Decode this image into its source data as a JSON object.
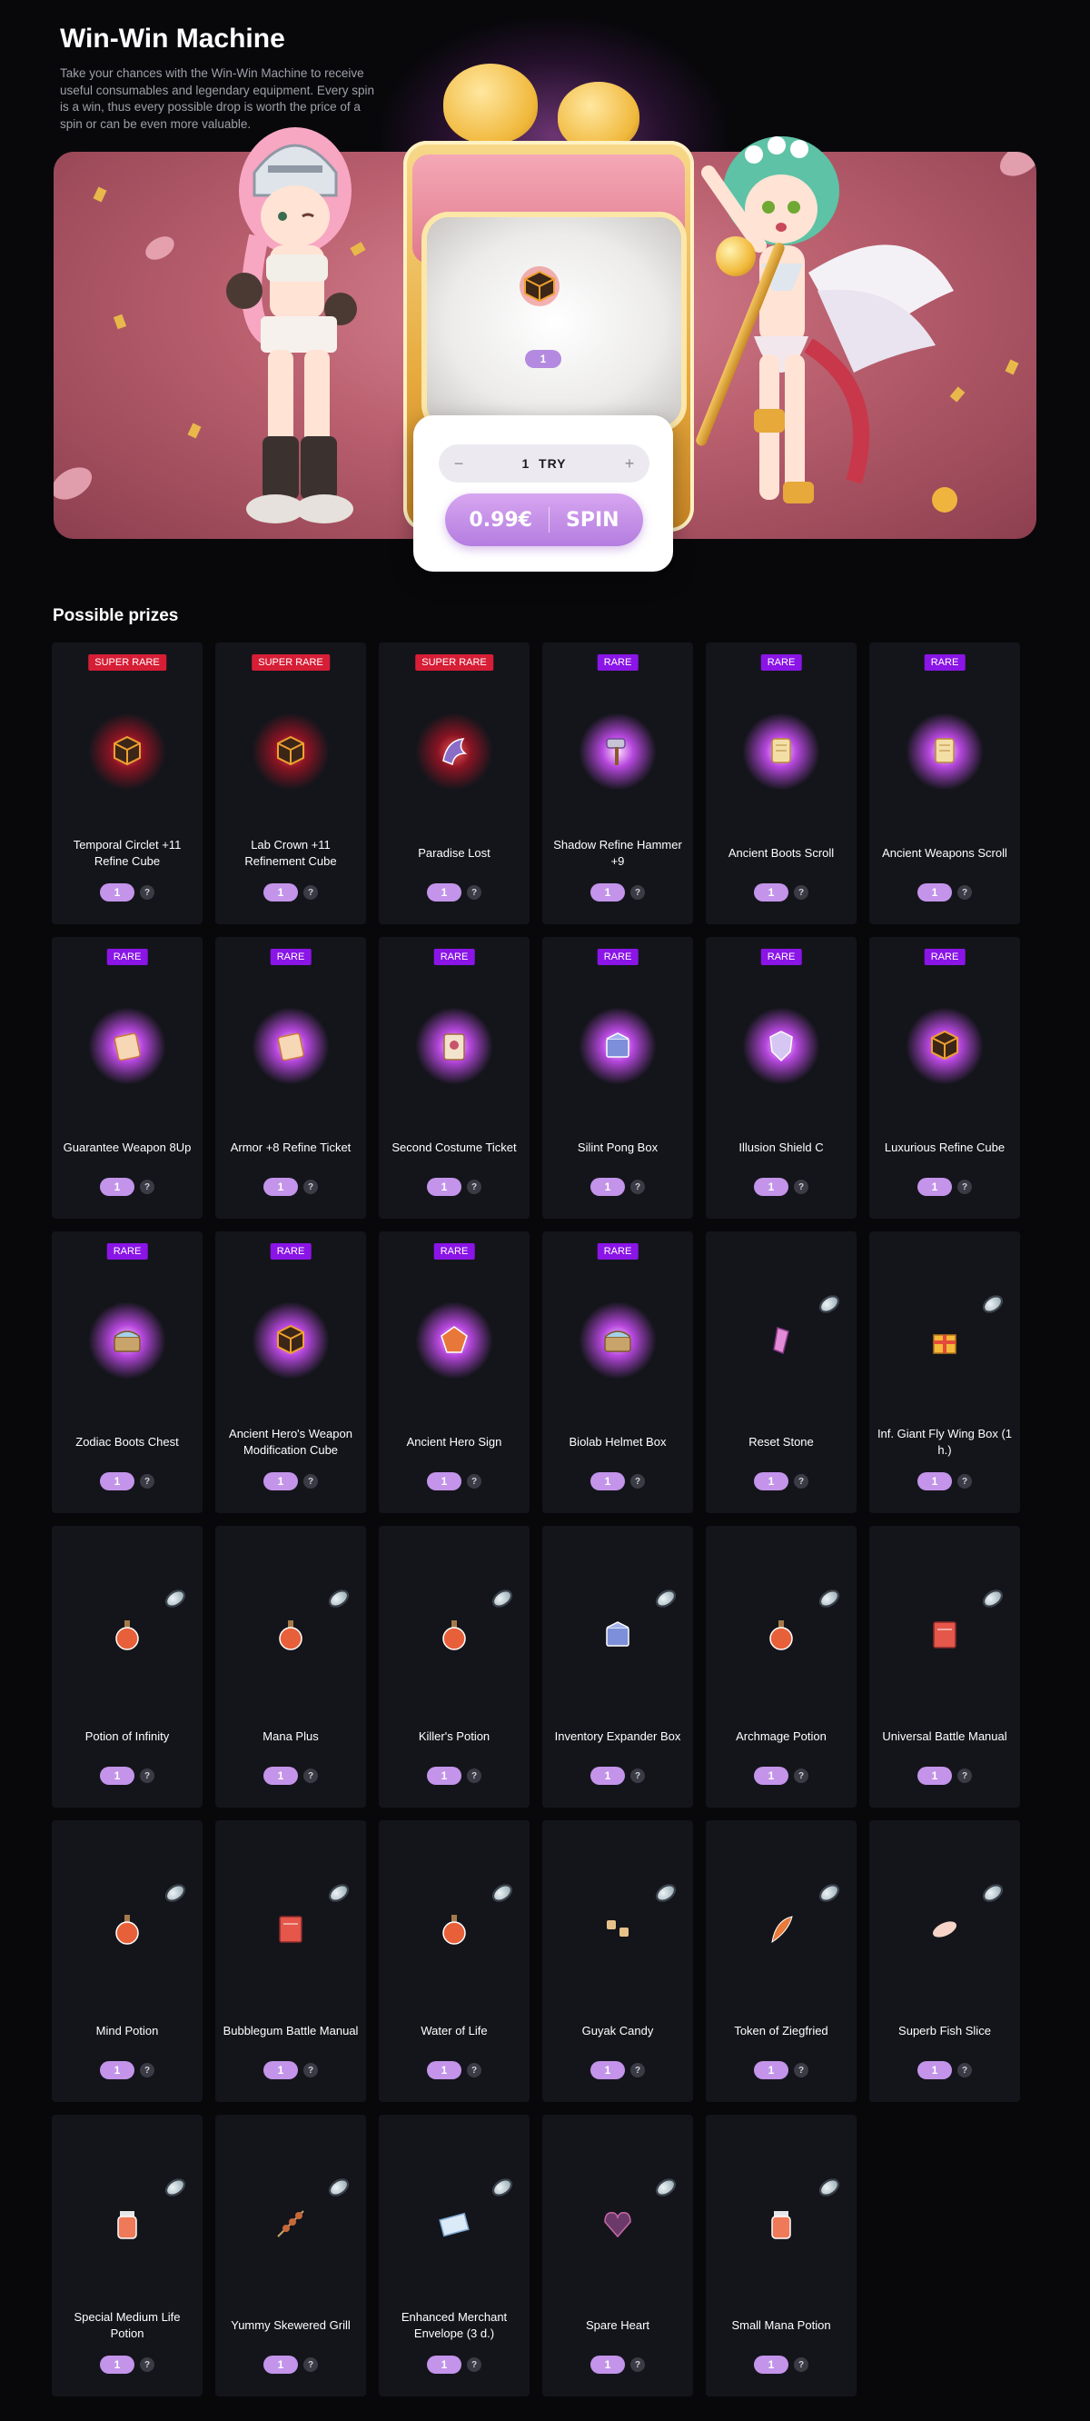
{
  "header": {
    "title": "Win-Win Machine",
    "description": "Take your chances with the Win-Win Machine to receive useful consumables and legendary equipment. Every spin is a win, thus every possible drop is worth the price of a spin or can be even more valuable."
  },
  "machine": {
    "screen_item_icon": "cube-icon",
    "screen_count": "1",
    "try_minus": "−",
    "try_label": "1  TRY",
    "try_plus": "+",
    "spin_price": "0.99€",
    "spin_label": "SPIN"
  },
  "colors": {
    "super_rare": "#d61e36",
    "rare": "#8a15e6",
    "accent": "#c394ea",
    "card_bg": "#14151b"
  },
  "prizes": {
    "title": "Possible prizes",
    "items": [
      {
        "badge": "SUPER RARE",
        "tier": "super",
        "name": "Temporal Circlet +11 Refine Cube",
        "qty": "1",
        "icon": "cube-icon"
      },
      {
        "badge": "SUPER RARE",
        "tier": "super",
        "name": "Lab Crown +11 Refinement Cube",
        "qty": "1",
        "icon": "cube-icon"
      },
      {
        "badge": "SUPER RARE",
        "tier": "super",
        "name": "Paradise Lost",
        "qty": "1",
        "icon": "dragon-icon"
      },
      {
        "badge": "RARE",
        "tier": "rare",
        "name": "Shadow Refine Hammer +9",
        "qty": "1",
        "icon": "hammer-icon"
      },
      {
        "badge": "RARE",
        "tier": "rare",
        "name": "Ancient Boots Scroll",
        "qty": "1",
        "icon": "scroll-icon"
      },
      {
        "badge": "RARE",
        "tier": "rare",
        "name": "Ancient Weapons Scroll",
        "qty": "1",
        "icon": "scroll-icon"
      },
      {
        "badge": "RARE",
        "tier": "rare",
        "name": "Guarantee Weapon 8Up",
        "qty": "1",
        "icon": "ticket-icon"
      },
      {
        "badge": "RARE",
        "tier": "rare",
        "name": "Armor +8 Refine Ticket",
        "qty": "1",
        "icon": "ticket-icon"
      },
      {
        "badge": "RARE",
        "tier": "rare",
        "name": "Second Costume Ticket",
        "qty": "1",
        "icon": "card-icon"
      },
      {
        "badge": "RARE",
        "tier": "rare",
        "name": "Silint Pong Box",
        "qty": "1",
        "icon": "box-icon"
      },
      {
        "badge": "RARE",
        "tier": "rare",
        "name": "Illusion Shield C",
        "qty": "1",
        "icon": "shield-icon"
      },
      {
        "badge": "RARE",
        "tier": "rare",
        "name": "Luxurious Refine Cube",
        "qty": "1",
        "icon": "cube-icon"
      },
      {
        "badge": "RARE",
        "tier": "rare",
        "name": "Zodiac Boots Chest",
        "qty": "1",
        "icon": "chest-icon"
      },
      {
        "badge": "RARE",
        "tier": "rare",
        "name": "Ancient Hero's Weapon Modification Cube",
        "qty": "1",
        "icon": "cube-icon"
      },
      {
        "badge": "RARE",
        "tier": "rare",
        "name": "Ancient Hero Sign",
        "qty": "1",
        "icon": "emblem-icon"
      },
      {
        "badge": "RARE",
        "tier": "rare",
        "name": "Biolab Helmet Box",
        "qty": "1",
        "icon": "chest-icon"
      },
      {
        "badge": "",
        "tier": "common",
        "name": "Reset Stone",
        "qty": "1",
        "icon": "stone-icon"
      },
      {
        "badge": "",
        "tier": "common",
        "name": "Inf. Giant Fly Wing Box (1 h.)",
        "qty": "1",
        "icon": "gift-icon"
      },
      {
        "badge": "",
        "tier": "common",
        "name": "Potion of Infinity",
        "qty": "1",
        "icon": "potion-icon"
      },
      {
        "badge": "",
        "tier": "common",
        "name": "Mana Plus",
        "qty": "1",
        "icon": "potion-icon"
      },
      {
        "badge": "",
        "tier": "common",
        "name": "Killer's Potion",
        "qty": "1",
        "icon": "potion-icon"
      },
      {
        "badge": "",
        "tier": "common",
        "name": "Inventory Expander Box",
        "qty": "1",
        "icon": "box-icon"
      },
      {
        "badge": "",
        "tier": "common",
        "name": "Archmage Potion",
        "qty": "1",
        "icon": "potion-icon"
      },
      {
        "badge": "",
        "tier": "common",
        "name": "Universal Battle Manual",
        "qty": "1",
        "icon": "book-icon"
      },
      {
        "badge": "",
        "tier": "common",
        "name": "Mind Potion",
        "qty": "1",
        "icon": "potion-icon"
      },
      {
        "badge": "",
        "tier": "common",
        "name": "Bubblegum Battle Manual",
        "qty": "1",
        "icon": "book-icon"
      },
      {
        "badge": "",
        "tier": "common",
        "name": "Water of Life",
        "qty": "1",
        "icon": "potion-icon"
      },
      {
        "badge": "",
        "tier": "common",
        "name": "Guyak Candy",
        "qty": "1",
        "icon": "candy-icon"
      },
      {
        "badge": "",
        "tier": "common",
        "name": "Token of Ziegfried",
        "qty": "1",
        "icon": "feather-icon"
      },
      {
        "badge": "",
        "tier": "common",
        "name": "Superb Fish Slice",
        "qty": "1",
        "icon": "fish-icon"
      },
      {
        "badge": "",
        "tier": "common",
        "name": "Special Medium Life Potion",
        "qty": "1",
        "icon": "jar-icon"
      },
      {
        "badge": "",
        "tier": "common",
        "name": "Yummy Skewered Grill",
        "qty": "1",
        "icon": "skewer-icon"
      },
      {
        "badge": "",
        "tier": "common",
        "name": "Enhanced Merchant Envelope (3 d.)",
        "qty": "1",
        "icon": "envelope-icon"
      },
      {
        "badge": "",
        "tier": "common",
        "name": "Spare Heart",
        "qty": "1",
        "icon": "heart-icon"
      },
      {
        "badge": "",
        "tier": "common",
        "name": "Small Mana Potion",
        "qty": "1",
        "icon": "jar-icon"
      }
    ]
  }
}
